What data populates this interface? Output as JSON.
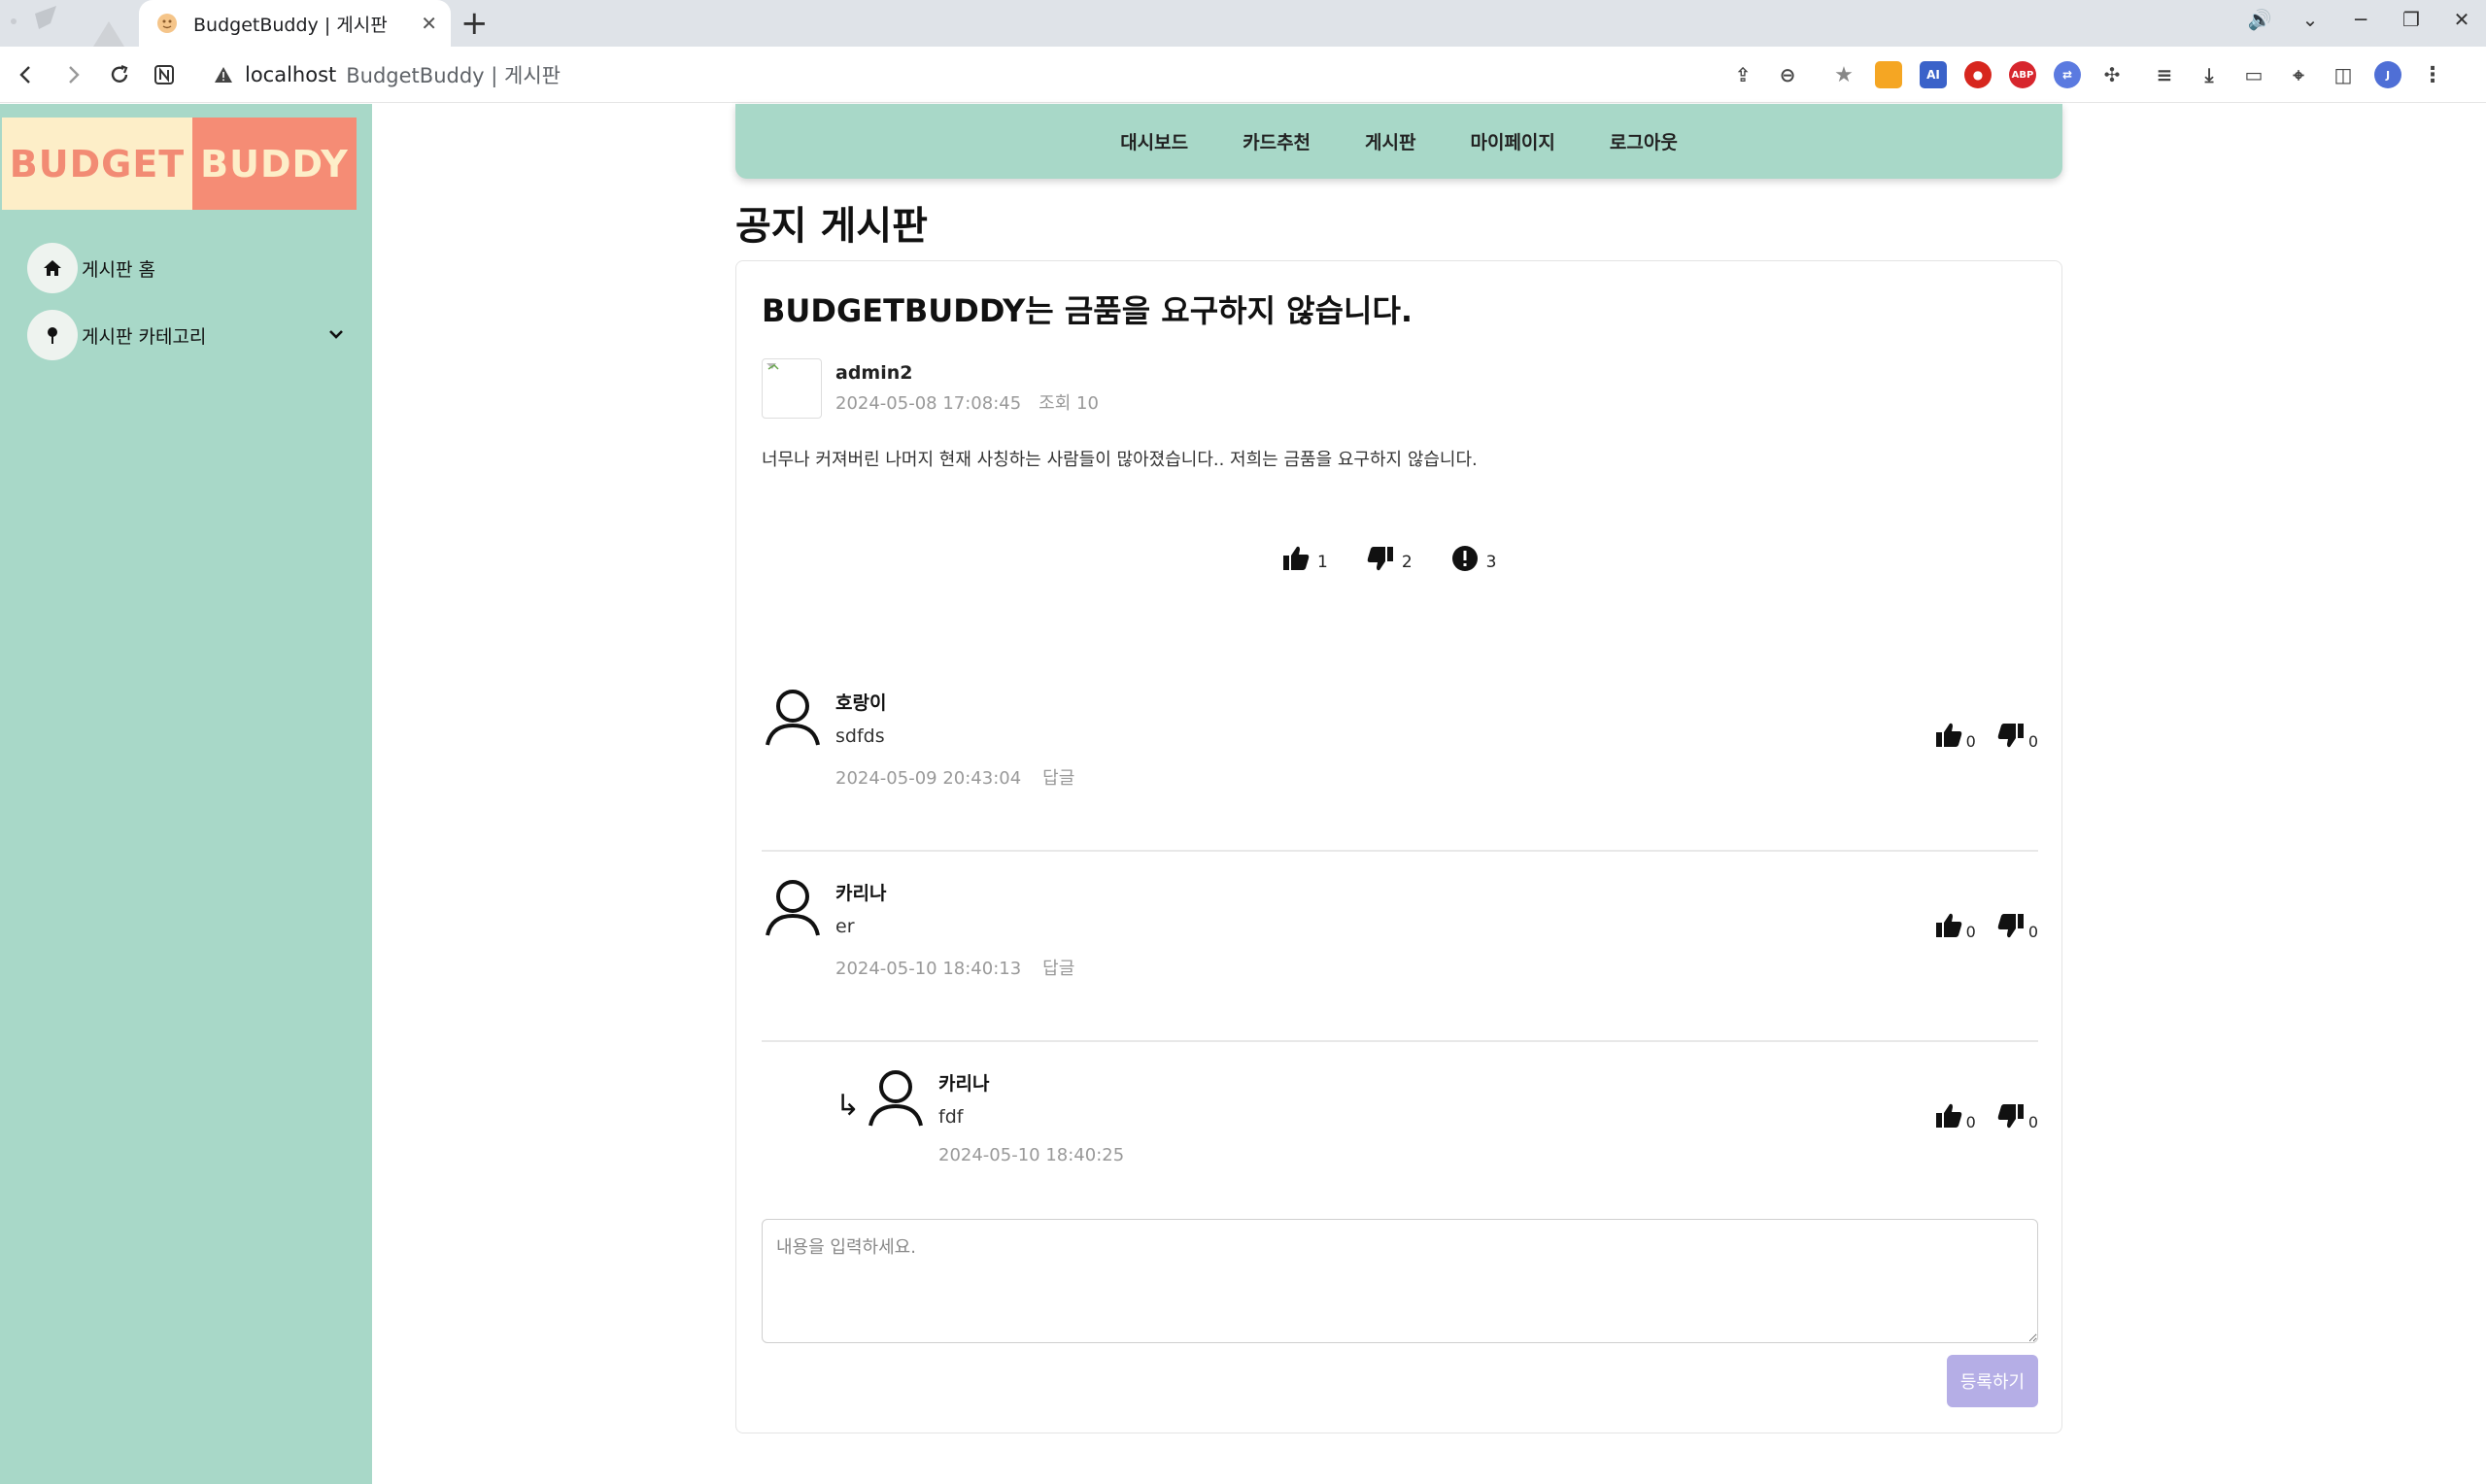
{
  "browser": {
    "tab_title": "BudgetBuddy | 게시판",
    "url_host": "localhost",
    "url_rest": "BudgetBuddy | 게시판"
  },
  "sidebar": {
    "logo_left": "BUDGET",
    "logo_right": "BUDDY",
    "items": [
      {
        "label": "게시판 홈",
        "icon": "home-icon"
      },
      {
        "label": "게시판 카테고리",
        "icon": "pin-icon"
      }
    ]
  },
  "topnav": {
    "items": [
      "대시보드",
      "카드추천",
      "게시판",
      "마이페이지",
      "로그아웃"
    ]
  },
  "page_title": "공지 게시판",
  "post": {
    "title": "BUDGETBUDDY는 금품을 요구하지 않습니다.",
    "author": "admin2",
    "date": "2024-05-08 17:08:45",
    "views": "조회 10",
    "body": "너무나 커져버린 나머지 현재 사칭하는 사람들이 많아졌습니다.. 저희는 금품을 요구하지 않습니다.",
    "likes": "1",
    "dislikes": "2",
    "reports": "3"
  },
  "comments": [
    {
      "name": "호랑이",
      "text": "sdfds",
      "date": "2024-05-09 20:43:04",
      "reply_label": "답글",
      "likes": "0",
      "dislikes": "0"
    },
    {
      "name": "카리나",
      "text": "er",
      "date": "2024-05-10 18:40:13",
      "reply_label": "답글",
      "likes": "0",
      "dislikes": "0"
    },
    {
      "name": "카리나",
      "text": "fdf",
      "date": "2024-05-10 18:40:25",
      "likes": "0",
      "dislikes": "0",
      "is_reply": true
    }
  ],
  "reply_arrow": "↳",
  "comment_form": {
    "placeholder": "내용을 입력하세요.",
    "submit_label": "등록하기"
  },
  "colors": {
    "mint": "#a8d8c8",
    "logo_cream": "#fdeec8",
    "logo_coral": "#f58c75",
    "submit": "#b5aee6"
  }
}
